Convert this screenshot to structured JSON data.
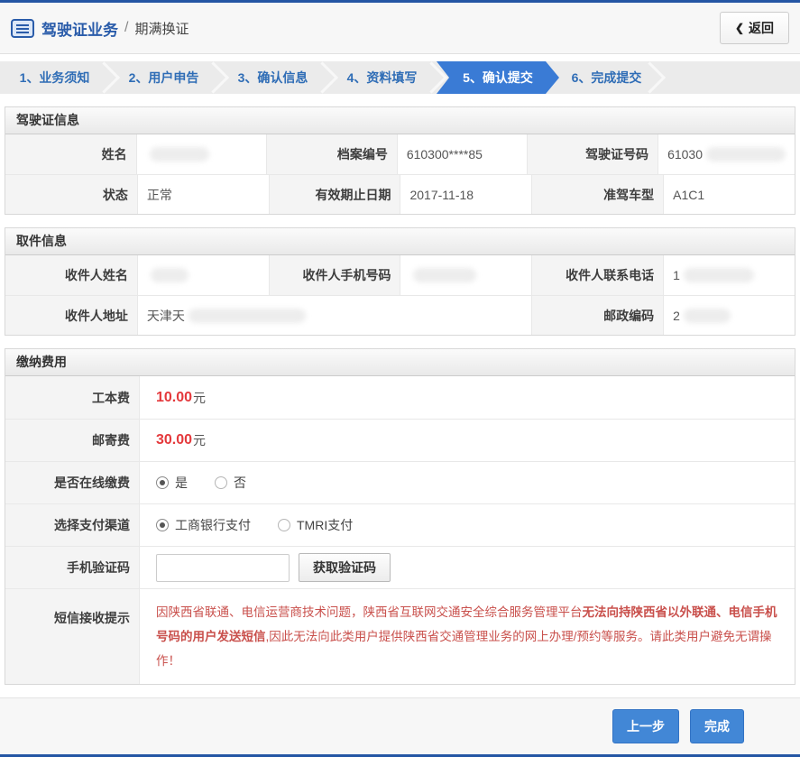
{
  "header": {
    "title": "驾驶证业务",
    "separator": "/",
    "subtitle": "期满换证",
    "back_chevron": "❮",
    "back_label": "返回"
  },
  "steps": {
    "items": [
      {
        "label": "1、业务须知",
        "active": false
      },
      {
        "label": "2、用户申告",
        "active": false
      },
      {
        "label": "3、确认信息",
        "active": false
      },
      {
        "label": "4、资料填写",
        "active": false
      },
      {
        "label": "5、确认提交",
        "active": true
      },
      {
        "label": "6、完成提交",
        "active": false
      }
    ]
  },
  "license_info": {
    "title": "驾驶证信息",
    "name_label": "姓名",
    "name_value": "",
    "file_number_label": "档案编号",
    "file_number_value": "610300****85",
    "license_number_label": "驾驶证号码",
    "license_number_value": "61030",
    "status_label": "状态",
    "status_value": "正常",
    "expiry_label": "有效期止日期",
    "expiry_value": "2017-11-18",
    "vehicle_class_label": "准驾车型",
    "vehicle_class_value": "A1C1"
  },
  "pickup_info": {
    "title": "取件信息",
    "recipient_name_label": "收件人姓名",
    "recipient_name_value": "",
    "recipient_mobile_label": "收件人手机号码",
    "recipient_mobile_value": "",
    "recipient_phone_label": "收件人联系电话",
    "recipient_phone_value": "1",
    "recipient_address_label": "收件人地址",
    "recipient_address_value": "天津天",
    "postal_code_label": "邮政编码",
    "postal_code_value": "2"
  },
  "payment": {
    "title": "缴纳费用",
    "cost_label": "工本费",
    "cost_value": "10.00",
    "cost_unit": "元",
    "postage_label": "邮寄费",
    "postage_value": "30.00",
    "postage_unit": "元",
    "online_pay_label": "是否在线缴费",
    "online_pay_options": [
      {
        "label": "是",
        "selected": true
      },
      {
        "label": "否",
        "selected": false
      }
    ],
    "channel_label": "选择支付渠道",
    "channel_options": [
      {
        "label": "工商银行支付",
        "selected": true
      },
      {
        "label": "TMRI支付",
        "selected": false
      }
    ],
    "sms_code_label": "手机验证码",
    "sms_code_value": "",
    "get_code_button": "获取验证码",
    "notice_label": "短信接收提示",
    "notice_segments": [
      {
        "text": "因陕西省联通、电信运营商技术问题，陕西省互联网交通安全综合服务管理平台",
        "bold": false
      },
      {
        "text": "无法向持陕西省以外联通、电信手机号码的用户发送短信",
        "bold": true
      },
      {
        "text": ",因此无法向此类用户提供陕西省交通管理业务的网上办理/预约等服务。请此类用户避免无谓操作！",
        "bold": false
      }
    ]
  },
  "footer": {
    "prev_button": "上一步",
    "finish_button": "完成"
  },
  "colors": {
    "top_border": "#2456a4",
    "accent_blue": "#3a7bd5",
    "title_blue": "#2a5caa",
    "fee_red": "#e4393c",
    "notice_red": "#c9504c",
    "section_header_bg": "#eeeeee",
    "label_cell_bg": "#f4f4f4"
  }
}
